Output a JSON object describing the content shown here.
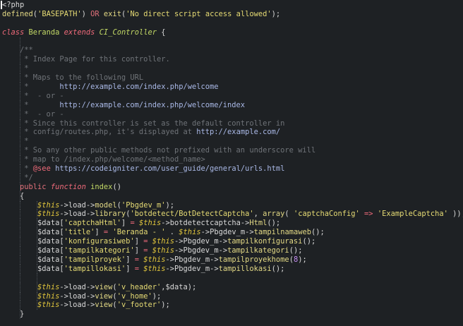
{
  "colors": {
    "background": "#1e2124",
    "plain": "#d8d8d8",
    "string": "#e6db74",
    "keyword": "#e0707a",
    "comment": "#6f7378",
    "url": "#a9b8e6",
    "variable": "#e0c53c",
    "function": "#c3d966",
    "number": "#c38cf0"
  },
  "lines": [
    {
      "indent": 0,
      "tokens": [
        {
          "t": "<?php",
          "c": "tag"
        }
      ]
    },
    {
      "indent": 0,
      "tokens": [
        {
          "t": "defined",
          "c": "func"
        },
        {
          "t": "(",
          "c": "plain"
        },
        {
          "t": "'BASEPATH'",
          "c": "string"
        },
        {
          "t": ") ",
          "c": "plain"
        },
        {
          "t": "OR",
          "c": "keyword"
        },
        {
          "t": " ",
          "c": "plain"
        },
        {
          "t": "exit",
          "c": "func"
        },
        {
          "t": "(",
          "c": "plain"
        },
        {
          "t": "'No direct script access allowed'",
          "c": "string"
        },
        {
          "t": ");",
          "c": "plain"
        }
      ]
    },
    {
      "indent": 0,
      "tokens": []
    },
    {
      "indent": 0,
      "tokens": [
        {
          "t": "class",
          "c": "storage"
        },
        {
          "t": " ",
          "c": "plain"
        },
        {
          "t": "Beranda",
          "c": "entity"
        },
        {
          "t": " ",
          "c": "plain"
        },
        {
          "t": "extends",
          "c": "storage"
        },
        {
          "t": " ",
          "c": "plain"
        },
        {
          "t": "CI_Controller",
          "c": "entity-i"
        },
        {
          "t": " {",
          "c": "plain"
        }
      ]
    },
    {
      "indent": 1,
      "tokens": []
    },
    {
      "indent": 1,
      "tokens": [
        {
          "t": "    /**",
          "c": "comment"
        }
      ]
    },
    {
      "indent": 1,
      "tokens": [
        {
          "t": "     * Index Page for this controller.",
          "c": "comment"
        }
      ]
    },
    {
      "indent": 1,
      "tokens": [
        {
          "t": "     *",
          "c": "comment"
        }
      ]
    },
    {
      "indent": 1,
      "tokens": [
        {
          "t": "     * Maps to the following URL",
          "c": "comment"
        }
      ]
    },
    {
      "indent": 1,
      "tokens": [
        {
          "t": "     *       ",
          "c": "comment"
        },
        {
          "t": "http://example.com/index.php/welcome",
          "c": "url"
        }
      ]
    },
    {
      "indent": 1,
      "tokens": [
        {
          "t": "     *  - or -",
          "c": "comment"
        }
      ]
    },
    {
      "indent": 1,
      "tokens": [
        {
          "t": "     *       ",
          "c": "comment"
        },
        {
          "t": "http://example.com/index.php/welcome/index",
          "c": "url"
        }
      ]
    },
    {
      "indent": 1,
      "tokens": [
        {
          "t": "     *  - or -",
          "c": "comment"
        }
      ]
    },
    {
      "indent": 1,
      "tokens": [
        {
          "t": "     * Since this controller is set as the default controller in",
          "c": "comment"
        }
      ]
    },
    {
      "indent": 1,
      "tokens": [
        {
          "t": "     * config/routes.php, it's displayed at ",
          "c": "comment"
        },
        {
          "t": "http://example.com/",
          "c": "url"
        }
      ]
    },
    {
      "indent": 1,
      "tokens": [
        {
          "t": "     *",
          "c": "comment"
        }
      ]
    },
    {
      "indent": 1,
      "tokens": [
        {
          "t": "     * So any other public methods not prefixed with an underscore will",
          "c": "comment"
        }
      ]
    },
    {
      "indent": 1,
      "tokens": [
        {
          "t": "     * map to /index.php/welcome/<method_name>",
          "c": "comment"
        }
      ]
    },
    {
      "indent": 1,
      "tokens": [
        {
          "t": "     * ",
          "c": "comment"
        },
        {
          "t": "@see",
          "c": "doctag"
        },
        {
          "t": " ",
          "c": "comment"
        },
        {
          "t": "https://codeigniter.com/user_guide/general/urls.html",
          "c": "url"
        }
      ]
    },
    {
      "indent": 1,
      "tokens": [
        {
          "t": "     */",
          "c": "comment"
        }
      ]
    },
    {
      "indent": 1,
      "tokens": [
        {
          "t": "    ",
          "c": "plain"
        },
        {
          "t": "public",
          "c": "keyword"
        },
        {
          "t": " ",
          "c": "plain"
        },
        {
          "t": "function",
          "c": "storage"
        },
        {
          "t": " ",
          "c": "plain"
        },
        {
          "t": "index",
          "c": "entity"
        },
        {
          "t": "()",
          "c": "plain"
        }
      ]
    },
    {
      "indent": 1,
      "tokens": [
        {
          "t": "    {",
          "c": "plain"
        }
      ]
    },
    {
      "indent": 2,
      "tokens": [
        {
          "t": "        ",
          "c": "plain"
        },
        {
          "t": "$this",
          "c": "var"
        },
        {
          "t": "->",
          "c": "plain"
        },
        {
          "t": "load",
          "c": "plain"
        },
        {
          "t": "->",
          "c": "plain"
        },
        {
          "t": "model",
          "c": "method"
        },
        {
          "t": "(",
          "c": "plain"
        },
        {
          "t": "'Pbgdev_m'",
          "c": "string"
        },
        {
          "t": ");",
          "c": "plain"
        }
      ]
    },
    {
      "indent": 2,
      "tokens": [
        {
          "t": "        ",
          "c": "plain"
        },
        {
          "t": "$this",
          "c": "var"
        },
        {
          "t": "->",
          "c": "plain"
        },
        {
          "t": "load",
          "c": "plain"
        },
        {
          "t": "->",
          "c": "plain"
        },
        {
          "t": "library",
          "c": "method"
        },
        {
          "t": "(",
          "c": "plain"
        },
        {
          "t": "'botdetect/BotDetectCaptcha'",
          "c": "string"
        },
        {
          "t": ", ",
          "c": "plain"
        },
        {
          "t": "array",
          "c": "func"
        },
        {
          "t": "( ",
          "c": "plain"
        },
        {
          "t": "'captchaConfig'",
          "c": "string"
        },
        {
          "t": " ",
          "c": "plain"
        },
        {
          "t": "=>",
          "c": "op"
        },
        {
          "t": " ",
          "c": "plain"
        },
        {
          "t": "'ExampleCaptcha'",
          "c": "string"
        },
        {
          "t": " ));",
          "c": "plain"
        }
      ]
    },
    {
      "indent": 2,
      "tokens": [
        {
          "t": "        $data[",
          "c": "plain"
        },
        {
          "t": "'captchaHtml'",
          "c": "string"
        },
        {
          "t": "] ",
          "c": "plain"
        },
        {
          "t": "=",
          "c": "op"
        },
        {
          "t": " ",
          "c": "plain"
        },
        {
          "t": "$this",
          "c": "var"
        },
        {
          "t": "->",
          "c": "plain"
        },
        {
          "t": "botdetectcaptcha",
          "c": "plain"
        },
        {
          "t": "->",
          "c": "plain"
        },
        {
          "t": "Html",
          "c": "method"
        },
        {
          "t": "();",
          "c": "plain"
        }
      ]
    },
    {
      "indent": 2,
      "tokens": [
        {
          "t": "        $data[",
          "c": "plain"
        },
        {
          "t": "'title'",
          "c": "string"
        },
        {
          "t": "] ",
          "c": "plain"
        },
        {
          "t": "=",
          "c": "op"
        },
        {
          "t": " ",
          "c": "plain"
        },
        {
          "t": "'Beranda - '",
          "c": "string"
        },
        {
          "t": " . ",
          "c": "plain"
        },
        {
          "t": "$this",
          "c": "var"
        },
        {
          "t": "->",
          "c": "plain"
        },
        {
          "t": "Pbgdev_m",
          "c": "plain"
        },
        {
          "t": "->",
          "c": "plain"
        },
        {
          "t": "tampilnamaweb",
          "c": "method"
        },
        {
          "t": "();",
          "c": "plain"
        }
      ]
    },
    {
      "indent": 2,
      "tokens": [
        {
          "t": "        $data[",
          "c": "plain"
        },
        {
          "t": "'konfigurasiweb'",
          "c": "string"
        },
        {
          "t": "] ",
          "c": "plain"
        },
        {
          "t": "=",
          "c": "op"
        },
        {
          "t": " ",
          "c": "plain"
        },
        {
          "t": "$this",
          "c": "var"
        },
        {
          "t": "->",
          "c": "plain"
        },
        {
          "t": "Pbgdev_m",
          "c": "plain"
        },
        {
          "t": "->",
          "c": "plain"
        },
        {
          "t": "tampilkonfigurasi",
          "c": "method"
        },
        {
          "t": "();",
          "c": "plain"
        }
      ]
    },
    {
      "indent": 2,
      "tokens": [
        {
          "t": "        $data[",
          "c": "plain"
        },
        {
          "t": "'tampilkategori'",
          "c": "string"
        },
        {
          "t": "] ",
          "c": "plain"
        },
        {
          "t": "=",
          "c": "op"
        },
        {
          "t": " ",
          "c": "plain"
        },
        {
          "t": "$this",
          "c": "var"
        },
        {
          "t": "->",
          "c": "plain"
        },
        {
          "t": "Pbgdev_m",
          "c": "plain"
        },
        {
          "t": "->",
          "c": "plain"
        },
        {
          "t": "tampilkategori",
          "c": "method"
        },
        {
          "t": "();",
          "c": "plain"
        }
      ]
    },
    {
      "indent": 2,
      "tokens": [
        {
          "t": "        $data[",
          "c": "plain"
        },
        {
          "t": "'tampilproyek'",
          "c": "string"
        },
        {
          "t": "] ",
          "c": "plain"
        },
        {
          "t": "=",
          "c": "op"
        },
        {
          "t": " ",
          "c": "plain"
        },
        {
          "t": "$this",
          "c": "var"
        },
        {
          "t": "->",
          "c": "plain"
        },
        {
          "t": "Pbgdev_m",
          "c": "plain"
        },
        {
          "t": "->",
          "c": "plain"
        },
        {
          "t": "tampilproyekhome",
          "c": "method"
        },
        {
          "t": "(",
          "c": "plain"
        },
        {
          "t": "8",
          "c": "num"
        },
        {
          "t": ");",
          "c": "plain"
        }
      ]
    },
    {
      "indent": 2,
      "tokens": [
        {
          "t": "        $data[",
          "c": "plain"
        },
        {
          "t": "'tampillokasi'",
          "c": "string"
        },
        {
          "t": "] ",
          "c": "plain"
        },
        {
          "t": "=",
          "c": "op"
        },
        {
          "t": " ",
          "c": "plain"
        },
        {
          "t": "$this",
          "c": "var"
        },
        {
          "t": "->",
          "c": "plain"
        },
        {
          "t": "Pbgdev_m",
          "c": "plain"
        },
        {
          "t": "->",
          "c": "plain"
        },
        {
          "t": "tampillokasi",
          "c": "method"
        },
        {
          "t": "();",
          "c": "plain"
        }
      ]
    },
    {
      "indent": 2,
      "tokens": []
    },
    {
      "indent": 2,
      "tokens": [
        {
          "t": "        ",
          "c": "plain"
        },
        {
          "t": "$this",
          "c": "var"
        },
        {
          "t": "->",
          "c": "plain"
        },
        {
          "t": "load",
          "c": "plain"
        },
        {
          "t": "->",
          "c": "plain"
        },
        {
          "t": "view",
          "c": "method"
        },
        {
          "t": "(",
          "c": "plain"
        },
        {
          "t": "'v_header'",
          "c": "string"
        },
        {
          "t": ",$data);",
          "c": "plain"
        }
      ]
    },
    {
      "indent": 2,
      "tokens": [
        {
          "t": "        ",
          "c": "plain"
        },
        {
          "t": "$this",
          "c": "var"
        },
        {
          "t": "->",
          "c": "plain"
        },
        {
          "t": "load",
          "c": "plain"
        },
        {
          "t": "->",
          "c": "plain"
        },
        {
          "t": "view",
          "c": "method"
        },
        {
          "t": "(",
          "c": "plain"
        },
        {
          "t": "'v_home'",
          "c": "string"
        },
        {
          "t": ");",
          "c": "plain"
        }
      ]
    },
    {
      "indent": 2,
      "tokens": [
        {
          "t": "        ",
          "c": "plain"
        },
        {
          "t": "$this",
          "c": "var"
        },
        {
          "t": "->",
          "c": "plain"
        },
        {
          "t": "load",
          "c": "plain"
        },
        {
          "t": "->",
          "c": "plain"
        },
        {
          "t": "view",
          "c": "method"
        },
        {
          "t": "(",
          "c": "plain"
        },
        {
          "t": "'v_footer'",
          "c": "string"
        },
        {
          "t": ");",
          "c": "plain"
        }
      ]
    },
    {
      "indent": 1,
      "tokens": [
        {
          "t": "    }",
          "c": "plain"
        }
      ]
    }
  ]
}
